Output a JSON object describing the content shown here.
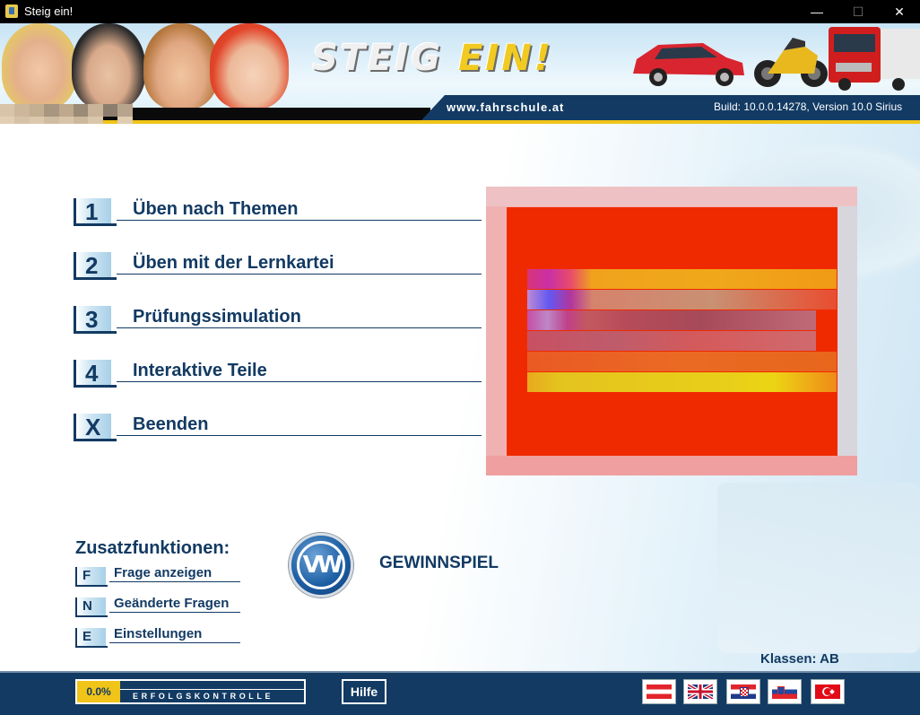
{
  "window": {
    "title": "Steig ein!",
    "minimize": "—",
    "maximize": "☐",
    "close": "✕"
  },
  "header": {
    "logo_part1": "STEIG",
    "logo_part2": "EIN!",
    "url": "www.fahrschule.at",
    "build": "Build: 10.0.0.14278, Version 10.0 Sirius"
  },
  "menu": [
    {
      "key": "1",
      "label": "Üben nach Themen"
    },
    {
      "key": "2",
      "label": "Üben mit der Lernkartei"
    },
    {
      "key": "3",
      "label": "Prüfungssimulation"
    },
    {
      "key": "4",
      "label": "Interaktive Teile"
    },
    {
      "key": "X",
      "label": "Beenden"
    }
  ],
  "extras": {
    "title": "Zusatzfunktionen:",
    "items": [
      {
        "key": "F",
        "label": "Frage anzeigen"
      },
      {
        "key": "N",
        "label": "Geänderte Fragen"
      },
      {
        "key": "E",
        "label": "Einstellungen"
      }
    ]
  },
  "sponsor": {
    "logo_text": "VW",
    "link": "GEWINNSPIEL"
  },
  "klassen": "Klassen: AB",
  "footer": {
    "progress_value": "0.0%",
    "progress_label": "ERFOLGSKONTROLLE",
    "help": "Hilfe",
    "flags": [
      "austria-flag",
      "uk-flag",
      "croatia-flag",
      "slovenia-flag",
      "turkey-flag"
    ]
  },
  "colors": {
    "navy": "#123a63",
    "yellow": "#f0c419",
    "ad_red": "#f02a00"
  }
}
